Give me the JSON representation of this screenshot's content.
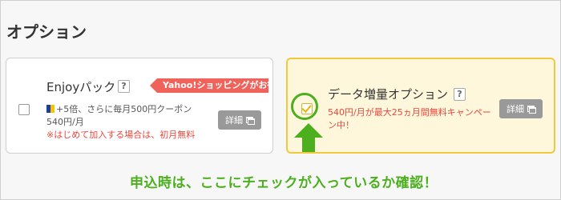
{
  "section": {
    "title": "オプション"
  },
  "enjoy_card": {
    "title": "Enjoyパック",
    "help": "?",
    "promo_tag": "Yahoo!ショッピングがお得",
    "benefit": "+5倍、さらに毎月500円クーポン",
    "price": "540円/月",
    "notice": "※はじめて加入する場合は、初月無料",
    "detail_label": "詳細",
    "checked": false
  },
  "data_card": {
    "title": "データ増量オプション",
    "help": "?",
    "campaign": "540円/月が最大25ヵ月間無料キャンペーン中！",
    "detail_label": "詳細",
    "checked": true
  },
  "annotation": {
    "text": "申込時は、ここにチェックが入っているか確認！"
  },
  "colors": {
    "highlight_green": "#4caf1e",
    "selected_border": "#f3c93c",
    "selected_background": "#fff7dc",
    "promo_red": "#f0625a",
    "notice_red": "#e8473e"
  }
}
